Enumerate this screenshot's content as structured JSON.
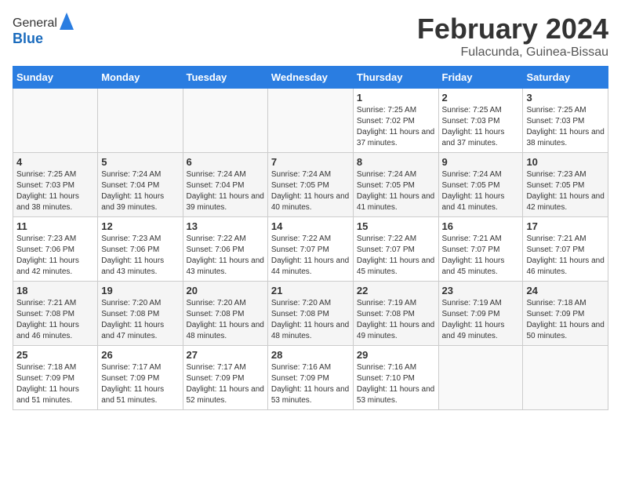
{
  "header": {
    "logo_line1": "General",
    "logo_line2": "Blue",
    "title": "February 2024",
    "subtitle": "Fulacunda, Guinea-Bissau"
  },
  "days_of_week": [
    "Sunday",
    "Monday",
    "Tuesday",
    "Wednesday",
    "Thursday",
    "Friday",
    "Saturday"
  ],
  "weeks": [
    [
      {
        "day": "",
        "info": ""
      },
      {
        "day": "",
        "info": ""
      },
      {
        "day": "",
        "info": ""
      },
      {
        "day": "",
        "info": ""
      },
      {
        "day": "1",
        "info": "Sunrise: 7:25 AM\nSunset: 7:02 PM\nDaylight: 11 hours and 37 minutes."
      },
      {
        "day": "2",
        "info": "Sunrise: 7:25 AM\nSunset: 7:03 PM\nDaylight: 11 hours and 37 minutes."
      },
      {
        "day": "3",
        "info": "Sunrise: 7:25 AM\nSunset: 7:03 PM\nDaylight: 11 hours and 38 minutes."
      }
    ],
    [
      {
        "day": "4",
        "info": "Sunrise: 7:25 AM\nSunset: 7:03 PM\nDaylight: 11 hours and 38 minutes."
      },
      {
        "day": "5",
        "info": "Sunrise: 7:24 AM\nSunset: 7:04 PM\nDaylight: 11 hours and 39 minutes."
      },
      {
        "day": "6",
        "info": "Sunrise: 7:24 AM\nSunset: 7:04 PM\nDaylight: 11 hours and 39 minutes."
      },
      {
        "day": "7",
        "info": "Sunrise: 7:24 AM\nSunset: 7:05 PM\nDaylight: 11 hours and 40 minutes."
      },
      {
        "day": "8",
        "info": "Sunrise: 7:24 AM\nSunset: 7:05 PM\nDaylight: 11 hours and 41 minutes."
      },
      {
        "day": "9",
        "info": "Sunrise: 7:24 AM\nSunset: 7:05 PM\nDaylight: 11 hours and 41 minutes."
      },
      {
        "day": "10",
        "info": "Sunrise: 7:23 AM\nSunset: 7:05 PM\nDaylight: 11 hours and 42 minutes."
      }
    ],
    [
      {
        "day": "11",
        "info": "Sunrise: 7:23 AM\nSunset: 7:06 PM\nDaylight: 11 hours and 42 minutes."
      },
      {
        "day": "12",
        "info": "Sunrise: 7:23 AM\nSunset: 7:06 PM\nDaylight: 11 hours and 43 minutes."
      },
      {
        "day": "13",
        "info": "Sunrise: 7:22 AM\nSunset: 7:06 PM\nDaylight: 11 hours and 43 minutes."
      },
      {
        "day": "14",
        "info": "Sunrise: 7:22 AM\nSunset: 7:07 PM\nDaylight: 11 hours and 44 minutes."
      },
      {
        "day": "15",
        "info": "Sunrise: 7:22 AM\nSunset: 7:07 PM\nDaylight: 11 hours and 45 minutes."
      },
      {
        "day": "16",
        "info": "Sunrise: 7:21 AM\nSunset: 7:07 PM\nDaylight: 11 hours and 45 minutes."
      },
      {
        "day": "17",
        "info": "Sunrise: 7:21 AM\nSunset: 7:07 PM\nDaylight: 11 hours and 46 minutes."
      }
    ],
    [
      {
        "day": "18",
        "info": "Sunrise: 7:21 AM\nSunset: 7:08 PM\nDaylight: 11 hours and 46 minutes."
      },
      {
        "day": "19",
        "info": "Sunrise: 7:20 AM\nSunset: 7:08 PM\nDaylight: 11 hours and 47 minutes."
      },
      {
        "day": "20",
        "info": "Sunrise: 7:20 AM\nSunset: 7:08 PM\nDaylight: 11 hours and 48 minutes."
      },
      {
        "day": "21",
        "info": "Sunrise: 7:20 AM\nSunset: 7:08 PM\nDaylight: 11 hours and 48 minutes."
      },
      {
        "day": "22",
        "info": "Sunrise: 7:19 AM\nSunset: 7:08 PM\nDaylight: 11 hours and 49 minutes."
      },
      {
        "day": "23",
        "info": "Sunrise: 7:19 AM\nSunset: 7:09 PM\nDaylight: 11 hours and 49 minutes."
      },
      {
        "day": "24",
        "info": "Sunrise: 7:18 AM\nSunset: 7:09 PM\nDaylight: 11 hours and 50 minutes."
      }
    ],
    [
      {
        "day": "25",
        "info": "Sunrise: 7:18 AM\nSunset: 7:09 PM\nDaylight: 11 hours and 51 minutes."
      },
      {
        "day": "26",
        "info": "Sunrise: 7:17 AM\nSunset: 7:09 PM\nDaylight: 11 hours and 51 minutes."
      },
      {
        "day": "27",
        "info": "Sunrise: 7:17 AM\nSunset: 7:09 PM\nDaylight: 11 hours and 52 minutes."
      },
      {
        "day": "28",
        "info": "Sunrise: 7:16 AM\nSunset: 7:09 PM\nDaylight: 11 hours and 53 minutes."
      },
      {
        "day": "29",
        "info": "Sunrise: 7:16 AM\nSunset: 7:10 PM\nDaylight: 11 hours and 53 minutes."
      },
      {
        "day": "",
        "info": ""
      },
      {
        "day": "",
        "info": ""
      }
    ]
  ]
}
